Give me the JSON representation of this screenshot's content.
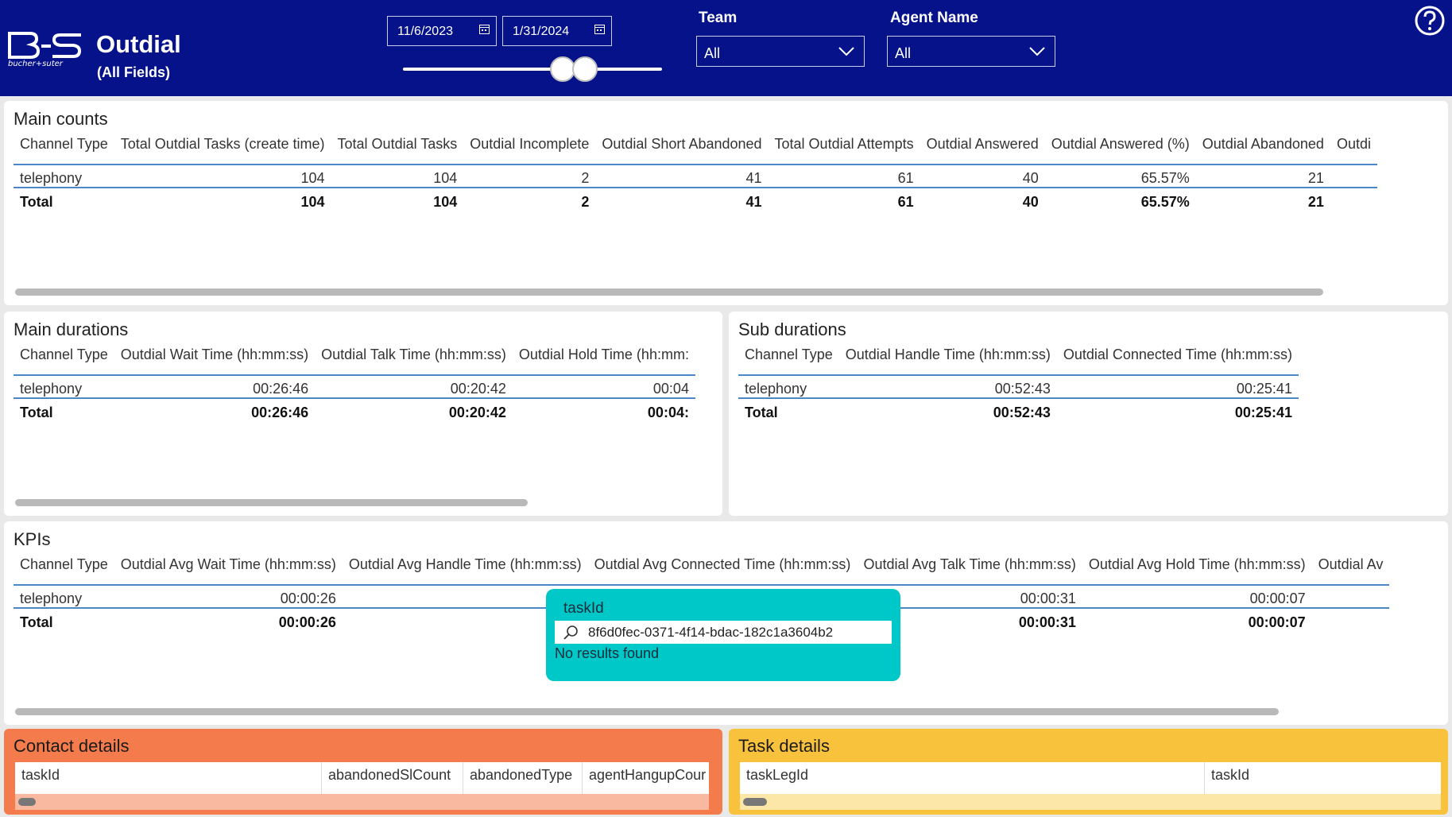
{
  "header": {
    "logo_text": "bucher+suter",
    "title": "Outdial",
    "subtitle": "(All Fields)",
    "date_start": "11/6/2023",
    "date_end": "1/31/2024",
    "team_label": "Team",
    "team_value": "All",
    "agent_label": "Agent Name",
    "agent_value": "All",
    "help_icon": "question-circle-icon"
  },
  "main_counts": {
    "title": "Main counts",
    "columns": [
      "Channel Type",
      "Total Outdial Tasks (create time)",
      "Total Outdial Tasks",
      "Outdial Incomplete",
      "Outdial Short Abandoned",
      "Total Outdial Attempts",
      "Outdial Answered",
      "Outdial Answered (%)",
      "Outdial Abandoned",
      "Outdi"
    ],
    "rows": [
      [
        "telephony",
        "104",
        "104",
        "2",
        "41",
        "61",
        "40",
        "65.57%",
        "21",
        ""
      ]
    ],
    "total": [
      "Total",
      "104",
      "104",
      "2",
      "41",
      "61",
      "40",
      "65.57%",
      "21",
      ""
    ]
  },
  "main_durations": {
    "title": "Main durations",
    "columns": [
      "Channel Type",
      "Outdial Wait Time (hh:mm:ss)",
      "Outdial Talk Time (hh:mm:ss)",
      "Outdial Hold Time (hh:mm:"
    ],
    "rows": [
      [
        "telephony",
        "00:26:46",
        "00:20:42",
        "00:04"
      ]
    ],
    "total": [
      "Total",
      "00:26:46",
      "00:20:42",
      "00:04:"
    ]
  },
  "sub_durations": {
    "title": "Sub durations",
    "columns": [
      "Channel Type",
      "Outdial Handle Time (hh:mm:ss)",
      "Outdial Connected Time (hh:mm:ss)"
    ],
    "rows": [
      [
        "telephony",
        "00:52:43",
        "00:25:41"
      ]
    ],
    "total": [
      "Total",
      "00:52:43",
      "00:25:41"
    ]
  },
  "kpis": {
    "title": "KPIs",
    "columns": [
      "Channel Type",
      "Outdial Avg Wait Time (hh:mm:ss)",
      "Outdial Avg Handle Time (hh:mm:ss)",
      "Outdial Avg Connected Time (hh:mm:ss)",
      "Outdial Avg Talk Time (hh:mm:ss)",
      "Outdial Avg Hold Time (hh:mm:ss)",
      "Outdial Av"
    ],
    "rows": [
      [
        "telephony",
        "00:00:26",
        "",
        "",
        "00:00:31",
        "00:00:07",
        ""
      ]
    ],
    "total": [
      "Total",
      "00:00:26",
      "",
      "",
      "00:00:31",
      "00:00:07",
      ""
    ]
  },
  "search_popup": {
    "title": "taskId",
    "value": "8f6d0fec-0371-4f14-bdac-182c1a3604b2",
    "empty_message": "No results found"
  },
  "contact_details": {
    "title": "Contact details",
    "columns": [
      "taskId",
      "abandonedSlCount",
      "abandonedType",
      "agentHangupCour"
    ]
  },
  "task_details": {
    "title": "Task details",
    "columns": [
      "taskLegId",
      "taskId"
    ]
  },
  "colors": {
    "header_bg": "#06128a",
    "accent_line": "#4a86c8",
    "search_popup_bg": "#00c8c8",
    "contact_panel_bg": "#f47b4c",
    "task_panel_bg": "#f9c23c"
  }
}
